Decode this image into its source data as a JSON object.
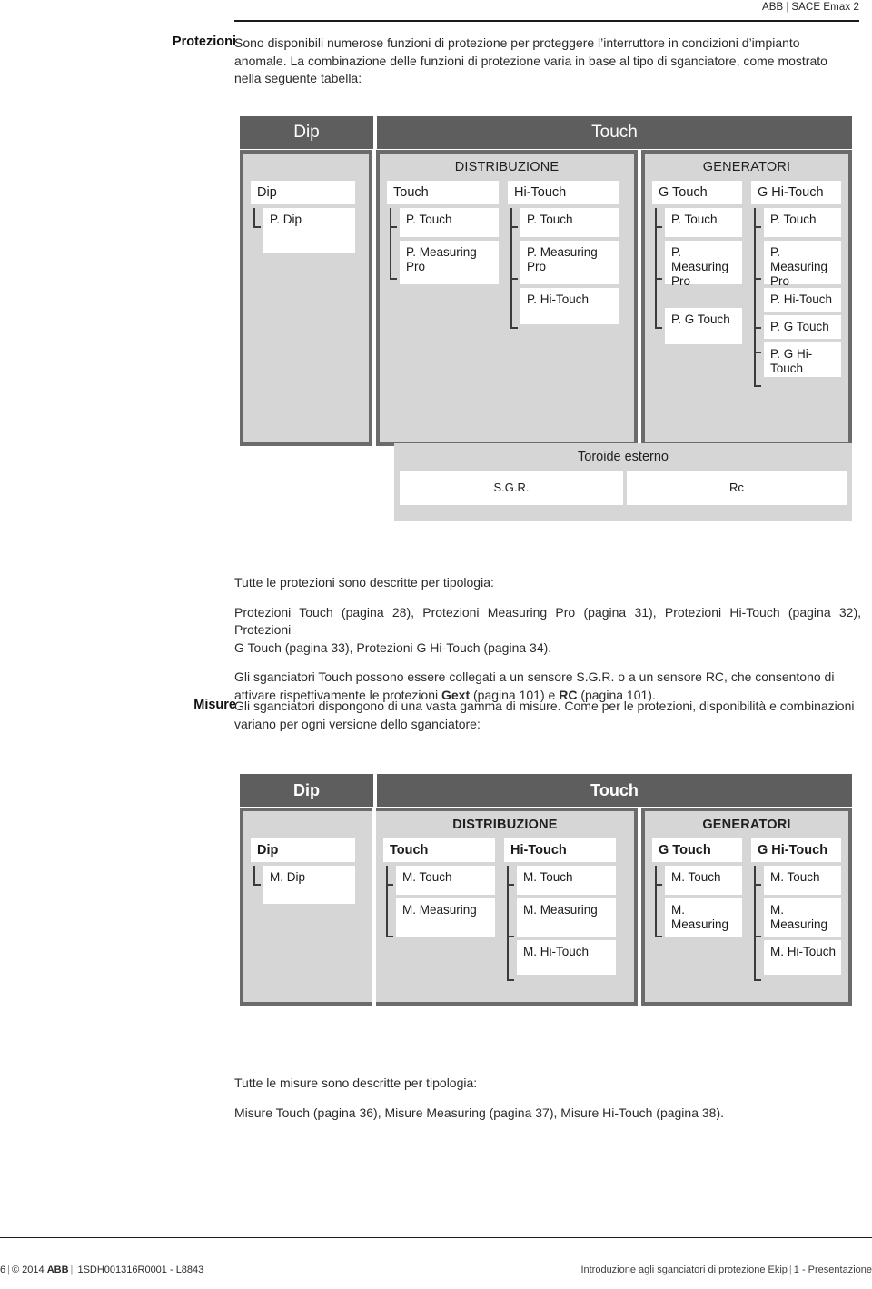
{
  "header": {
    "brand_left": "ABB",
    "brand_sep": "|",
    "brand_right": "SACE Emax 2"
  },
  "sections": {
    "protezioni": {
      "label": "Protezioni",
      "intro_line1": "Sono disponibili numerose funzioni di protezione per proteggere l’interruttore in condizioni d’impianto",
      "intro_line2": "anomale. La combinazione delle funzioni di protezione varia in base al tipo di sganciatore, come mostrato",
      "intro_line3": "nella seguente tabella:",
      "after_line1": "Tutte le protezioni sono descritte per tipologia:",
      "after_line2": "Protezioni Touch (pagina 28), Protezioni Measuring Pro (pagina 31), Protezioni Hi-Touch (pagina 32), Protezioni",
      "after_line3": "G Touch (pagina 33), Protezioni G Hi-Touch (pagina 34).",
      "after_line4_a": "Gli sganciatori Touch possono essere collegati a un sensore S.G.R. o a un sensore RC, che consentono di",
      "after_line5_a": "attivare rispettivamente le protezioni ",
      "after_line5_b": "Gext",
      "after_line5_c": " (pagina 101) e ",
      "after_line5_d": "RC",
      "after_line5_e": " (pagina 101)."
    },
    "misure": {
      "label": "Misure",
      "intro_line1": "Gli sganciatori dispongono di una vasta gamma di misure. Come per le protezioni, disponibilità e combinazioni",
      "intro_line2": "variano per ogni versione dello sganciatore:",
      "after_line1": "Tutte le misure sono descritte per tipologia:",
      "after_line2": "Misure Touch (pagina 36), Misure Measuring (pagina 37), Misure Hi-Touch (pagina 38)."
    }
  },
  "diagram_protezioni": {
    "head_dip": "Dip",
    "head_touch": "Touch",
    "cat_distribuzione": "DISTRIBUZIONE",
    "cat_generatori": "GENERATORI",
    "columns": [
      {
        "header": "Dip",
        "children": [
          "P. Dip"
        ]
      },
      {
        "header": "Touch",
        "children": [
          "P. Touch",
          "P. Measuring Pro"
        ]
      },
      {
        "header": "Hi-Touch",
        "children": [
          "P. Touch",
          "P. Measuring Pro",
          "P. Hi-Touch"
        ]
      },
      {
        "header": "G Touch",
        "children": [
          "P. Touch",
          "P. Measuring Pro",
          "P. G Touch"
        ]
      },
      {
        "header": "G Hi-Touch",
        "children": [
          "P. Touch",
          "P. Measuring Pro",
          "P. Hi-Touch",
          "P. G Touch",
          "P. G Hi-Touch"
        ]
      }
    ],
    "toroide": {
      "title": "Toroide esterno",
      "cells": [
        "S.G.R.",
        "Rc"
      ]
    }
  },
  "diagram_misure": {
    "head_dip": "Dip",
    "head_touch": "Touch",
    "cat_distribuzione": "DISTRIBUZIONE",
    "cat_generatori": "GENERATORI",
    "columns": [
      {
        "header": "Dip",
        "children": [
          "M. Dip"
        ]
      },
      {
        "header": "Touch",
        "children": [
          "M. Touch",
          "M. Measuring"
        ]
      },
      {
        "header": "Hi-Touch",
        "children": [
          "M. Touch",
          "M. Measuring",
          "M. Hi-Touch"
        ]
      },
      {
        "header": "G Touch",
        "children": [
          "M. Touch",
          "M. Measuring"
        ]
      },
      {
        "header": "G Hi-Touch",
        "children": [
          "M. Touch",
          "M. Measuring",
          "M. Hi-Touch"
        ]
      }
    ]
  },
  "footer": {
    "page_number": "6",
    "bar": "|",
    "copyright": "© 2014",
    "brand": "ABB",
    "doc_code": "1SDH001316R0001 - L8843",
    "right_text": "Introduzione agli sganciatori di protezione Ekip",
    "right_chapter": "1 - Presentazione"
  },
  "colors": {
    "head_bg": "#5e5e5e",
    "panel_bg": "#6b6b6b",
    "inner_bg": "#d6d6d6",
    "cell_bg": "#ffffff",
    "rule": "#1a1a1a"
  }
}
